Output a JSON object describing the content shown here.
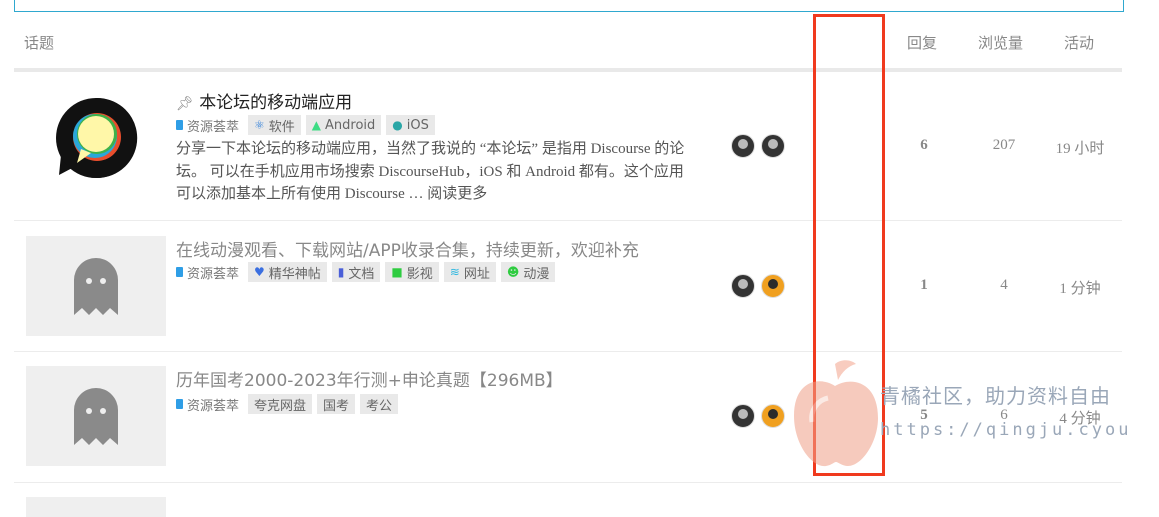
{
  "header": {
    "topic": "话题",
    "replies": "回复",
    "views": "浏览量",
    "activity": "活动"
  },
  "topics": [
    {
      "pin_icon": "pin-icon",
      "title": "本论坛的移动端应用",
      "category": "资源荟萃",
      "tags": [
        {
          "label": "软件",
          "icon": "software-icon"
        },
        {
          "label": "Android",
          "icon": "android-icon"
        },
        {
          "label": "iOS",
          "icon": "apple-icon"
        }
      ],
      "excerpt": "分享一下本论坛的移动端应用，当然了我说的 “本论坛” 是指用 Discourse 的论坛。 可以在手机应用市场搜索 DiscourseHub，iOS 和 Android 都有。这个应用可以添加基本上所有使用 Discourse … 阅读更多",
      "replies": "6",
      "views": "207",
      "activity": "19 小时"
    },
    {
      "title": "在线动漫观看、下载网站/APP收录合集，持续更新，欢迎补充",
      "category": "资源荟萃",
      "tags": [
        {
          "label": "精华神帖",
          "icon": "heart-icon"
        },
        {
          "label": "文档",
          "icon": "book-icon"
        },
        {
          "label": "影视",
          "icon": "video-icon"
        },
        {
          "label": "网址",
          "icon": "wifi-icon"
        },
        {
          "label": "动漫",
          "icon": "smile-icon"
        }
      ],
      "replies": "1",
      "views": "4",
      "activity": "1 分钟"
    },
    {
      "title": "历年国考2000-2023年行测+申论真题【296MB】",
      "category": "资源荟萃",
      "tags": [
        {
          "label": "夸克网盘"
        },
        {
          "label": "国考"
        },
        {
          "label": "考公"
        }
      ],
      "replies": "5",
      "views": "6",
      "activity": "4 分钟"
    }
  ],
  "watermark": {
    "line1": "青橘社区，助力资料自由",
    "line2": "https://qingju.cyou"
  },
  "colors": {
    "highlight_box": "#f03a1e",
    "category_square": "#2f9ee6",
    "search_border": "#2fa8cf"
  }
}
